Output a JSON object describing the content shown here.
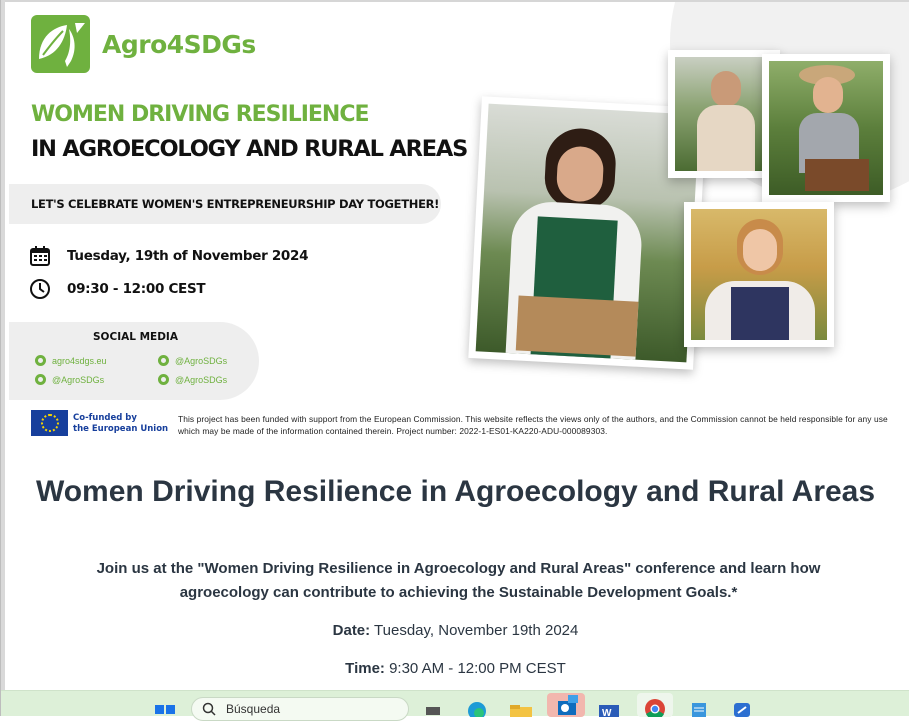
{
  "banner": {
    "brand": "Agro4SDGs",
    "headline_green": "WOMEN DRIVING RESILIENCE",
    "headline_dark": "IN AGROECOLOGY AND RURAL AREAS",
    "pill_text": "LET'S CELEBRATE WOMEN'S ENTREPRENEURSHIP DAY TOGETHER!",
    "date_text": "Tuesday, 19th of November 2024",
    "time_text": "09:30 - 12:00 CEST",
    "social_title": "SOCIAL MEDIA",
    "social": [
      {
        "icon": "web-icon",
        "label": "agro4sdgs.eu"
      },
      {
        "icon": "instagram-icon",
        "label": "@AgroSDGs"
      },
      {
        "icon": "facebook-icon",
        "label": "@AgroSDGs"
      },
      {
        "icon": "twitter-icon",
        "label": "@AgroSDGs"
      }
    ],
    "eu_line1": "Co-funded by",
    "eu_line2": "the European Union",
    "disclaimer": "This project has been funded with support from the European Commission. This website reflects the views only of the authors, and the Commission cannot be held responsible for any use which may be made of the information contained therein. Project number: 2022-1-ES01-KA220-ADU-000089303."
  },
  "page": {
    "title": "Women Driving Resilience in Agroecology and Rural Areas",
    "lead": "Join us at the \"Women Driving Resilience in Agroecology and Rural Areas\" conference and learn how agroecology can contribute to achieving the Sustainable Development Goals.*",
    "date_label": "Date:",
    "date_value": " Tuesday, November 19th 2024",
    "time_label": "Time:",
    "time_value": " 9:30 AM - 12:00 PM CEST"
  },
  "taskbar": {
    "search_placeholder": "Búsqueda",
    "apps": [
      "start-icon",
      "search-icon",
      "task-view-icon",
      "edge-icon",
      "file-explorer-icon",
      "outlook-icon",
      "word-icon",
      "chrome-icon",
      "notepad-icon",
      "app-icon"
    ]
  },
  "colors": {
    "brand_green": "#6fb13f",
    "text_dark": "#2b3642",
    "taskbar": "#ddf0d8",
    "eu_blue": "#173f9c"
  }
}
